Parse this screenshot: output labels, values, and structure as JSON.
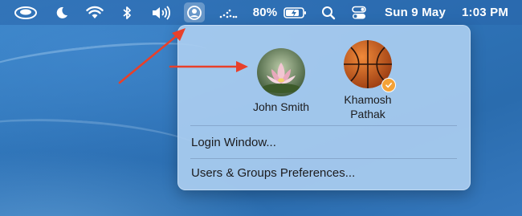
{
  "menubar": {
    "items": [
      {
        "name": "coffee-cup-icon"
      },
      {
        "name": "moon-icon"
      },
      {
        "name": "wifi-icon"
      },
      {
        "name": "bluetooth-icon"
      },
      {
        "name": "volume-icon"
      },
      {
        "name": "user-icon"
      },
      {
        "name": "activity-icon"
      },
      {
        "name": "search-icon"
      },
      {
        "name": "control-center-icon"
      }
    ],
    "battery_percent": "80%",
    "date": "Sun 9 May",
    "time": "1:03 PM"
  },
  "fast_user_switching": {
    "users": [
      {
        "name": "John Smith",
        "avatar": "lotus-flower",
        "logged_in": false
      },
      {
        "name_line1": "Khamosh",
        "name_line2": "Pathak",
        "avatar": "basketball",
        "logged_in": true
      }
    ],
    "menu": {
      "login_window": "Login Window...",
      "users_groups_prefs": "Users & Groups Preferences..."
    }
  },
  "colors": {
    "accent_badge": "#f4a237",
    "annotation_arrow": "#e8402a"
  }
}
